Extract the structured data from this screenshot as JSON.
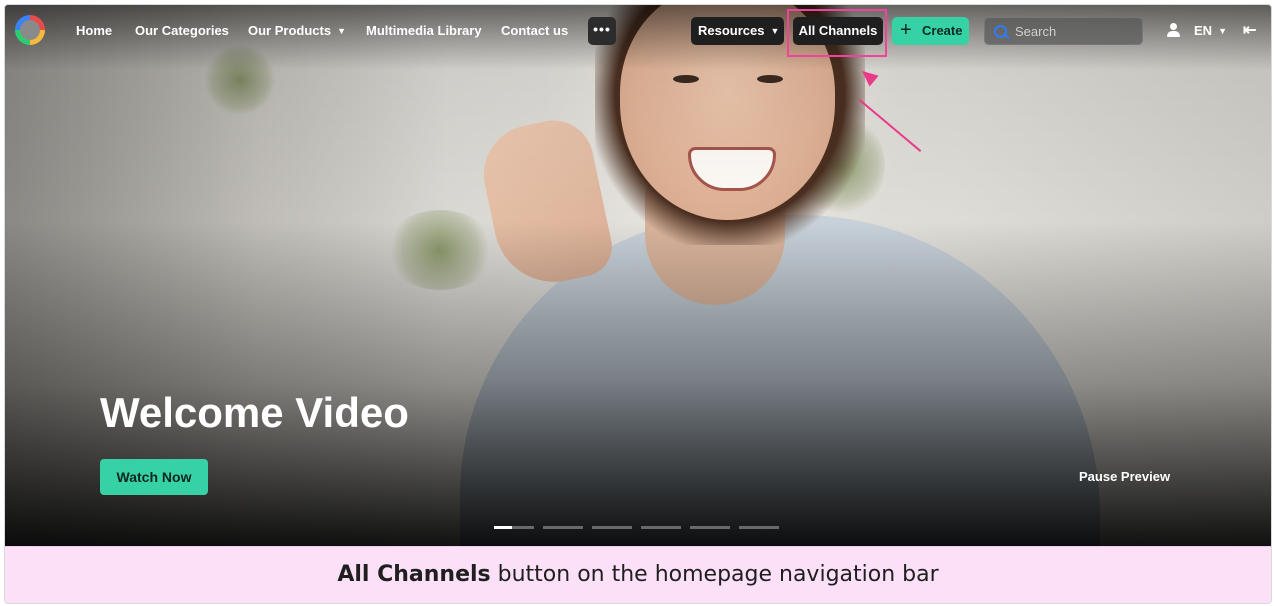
{
  "nav": {
    "links": [
      {
        "label": "Home"
      },
      {
        "label": "Our Categories"
      },
      {
        "label": "Our Products"
      },
      {
        "label": "Multimedia Library"
      },
      {
        "label": "Contact us"
      }
    ],
    "more_label": "•••",
    "resources_label": "Resources",
    "all_channels_label": "All Channels",
    "create_plus": "+",
    "create_label": "Create",
    "search_placeholder": "Search",
    "language": "EN",
    "exit_glyph": "⇤"
  },
  "hero": {
    "title": "Welcome Video",
    "watch_label": "Watch Now",
    "pause_label": "Pause Preview",
    "slide_count": 6,
    "active_slide": 1
  },
  "caption": {
    "bold": "All Channels",
    "rest": " button on the homepage navigation bar"
  },
  "colors": {
    "accent": "#36d1a5",
    "highlight": "#f0449b",
    "caption_bg": "#fbe0f8"
  }
}
